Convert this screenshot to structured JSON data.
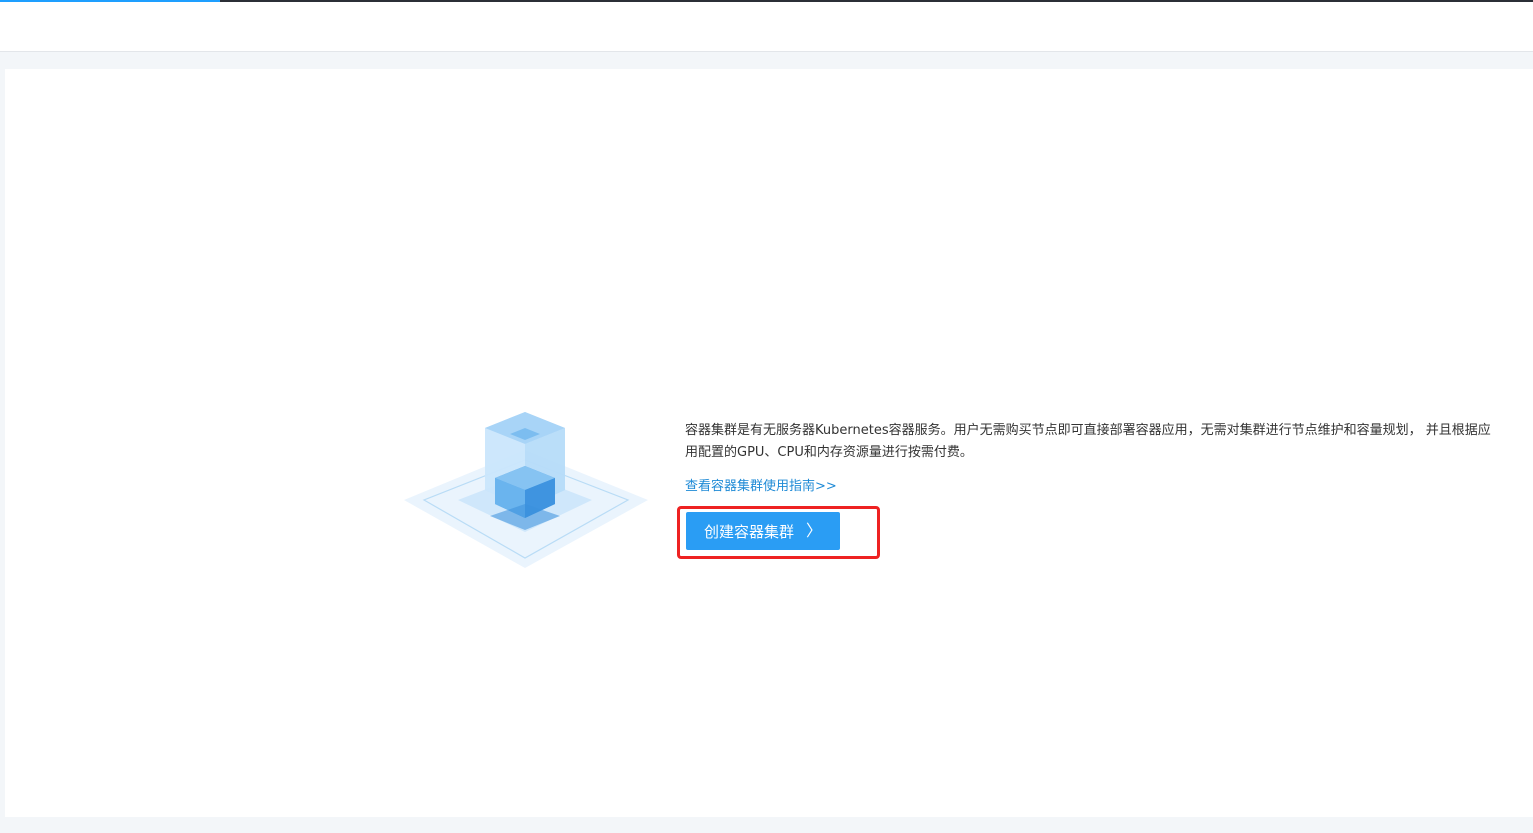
{
  "empty_state": {
    "description": "容器集群是有无服务器Kubernetes容器服务。用户无需购买节点即可直接部署容器应用，无需对集群进行节点维护和容量规划， 并且根据应用配置的GPU、CPU和内存资源量进行按需付费。",
    "guide_link": "查看容器集群使用指南>>",
    "create_button": "创建容器集群",
    "chevron": "〉"
  },
  "colors": {
    "accent": "#2a9df4",
    "link": "#1e8ad6",
    "highlight": "#ee2222",
    "progress": "#1e9fff"
  }
}
